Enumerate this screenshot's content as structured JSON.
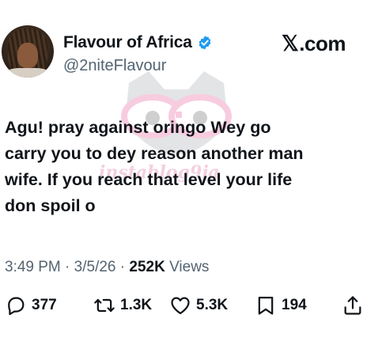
{
  "author": {
    "name": "Flavour of Africa",
    "handle": "@2niteFlavour",
    "verified": true,
    "verified_color": "#1d9bf0"
  },
  "source": {
    "label": ".com",
    "logo_icon": "x-logo-icon"
  },
  "post": {
    "text": "Agu! pray against oringo Wey go\ncarry you to dey reason another man\nwife. If you reach that level your life\ndon spoil o"
  },
  "meta": {
    "time": "3:49 PM",
    "sep1": " · ",
    "date": "3/5/26",
    "sep2": " · ",
    "views_count": "252K",
    "views_label": " Views"
  },
  "actions": {
    "replies": "377",
    "reposts": "1.3K",
    "likes": "5.3K",
    "bookmarks": "194"
  },
  "watermark": {
    "text": "instablog9ja"
  }
}
